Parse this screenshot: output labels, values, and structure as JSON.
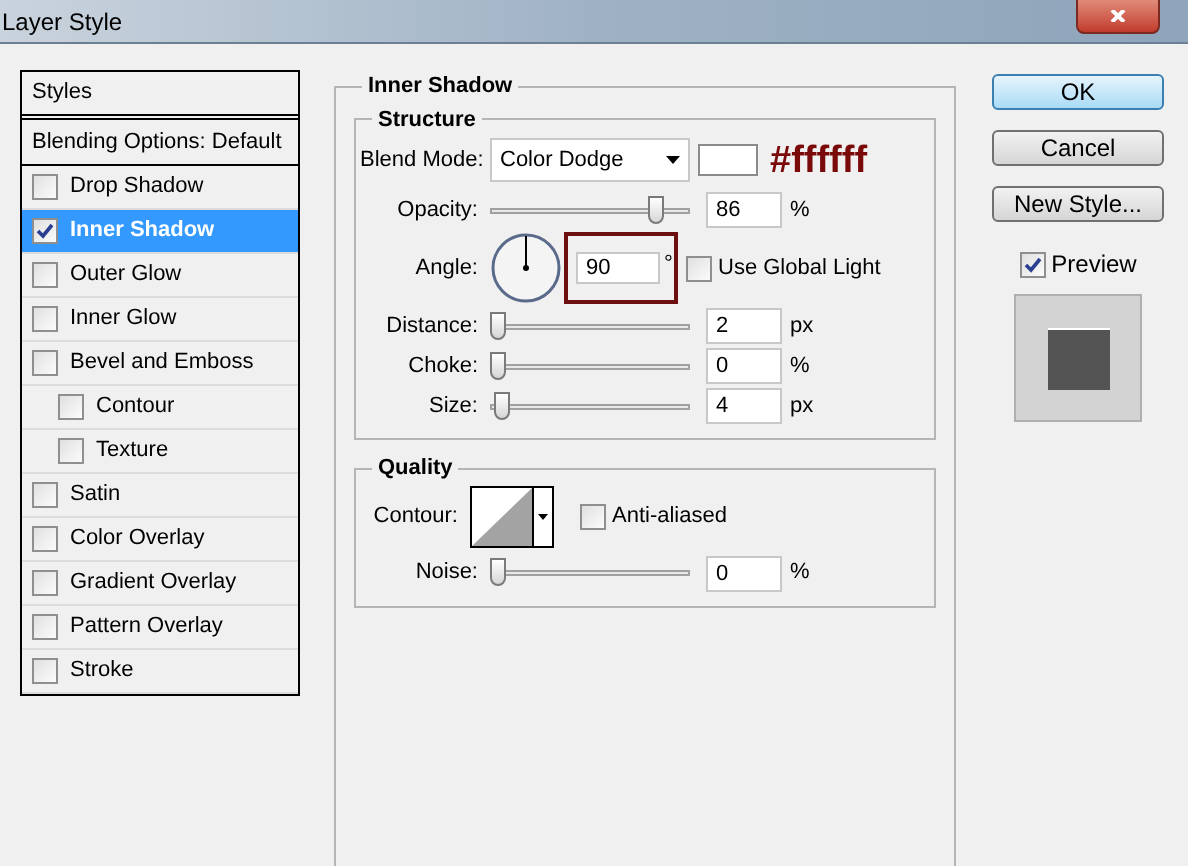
{
  "window": {
    "title": "Layer Style"
  },
  "styles_panel": {
    "header": "Styles",
    "blending_options": "Blending Options: Default",
    "items": [
      {
        "label": "Drop Shadow",
        "checked": false,
        "selected": false
      },
      {
        "label": "Inner Shadow",
        "checked": true,
        "selected": true
      },
      {
        "label": "Outer Glow",
        "checked": false,
        "selected": false
      },
      {
        "label": "Inner Glow",
        "checked": false,
        "selected": false
      },
      {
        "label": "Bevel and Emboss",
        "checked": false,
        "selected": false,
        "children": [
          {
            "label": "Contour",
            "checked": false,
            "selected": false
          },
          {
            "label": "Texture",
            "checked": false,
            "selected": false
          }
        ]
      },
      {
        "label": "Satin",
        "checked": false,
        "selected": false
      },
      {
        "label": "Color Overlay",
        "checked": false,
        "selected": false
      },
      {
        "label": "Gradient Overlay",
        "checked": false,
        "selected": false
      },
      {
        "label": "Pattern Overlay",
        "checked": false,
        "selected": false
      },
      {
        "label": "Stroke",
        "checked": false,
        "selected": false
      }
    ]
  },
  "effect": {
    "title": "Inner Shadow",
    "structure": {
      "title": "Structure",
      "blend_mode": {
        "label": "Blend Mode:",
        "value": "Color Dodge",
        "color": "#ffffff",
        "annotation": "#ffffff"
      },
      "sliders_top": [
        {
          "label": "Opacity:",
          "level": 0.86,
          "value": "86",
          "unit": "%"
        }
      ],
      "angle": {
        "label": "Angle:",
        "value": "90",
        "unit": "°",
        "highlighted": true,
        "global_light": {
          "label": "Use Global Light",
          "checked": false
        }
      },
      "sliders": [
        {
          "label": "Distance:",
          "level": 0.0,
          "value": "2",
          "unit": "px"
        },
        {
          "label": "Choke:",
          "level": 0.0,
          "value": "0",
          "unit": "%"
        },
        {
          "label": "Size:",
          "level": 0.02,
          "value": "4",
          "unit": "px"
        }
      ]
    },
    "quality": {
      "title": "Quality",
      "contour_label": "Contour:",
      "anti_aliased": {
        "label": "Anti-aliased",
        "checked": false
      },
      "sliders": [
        {
          "label": "Noise:",
          "level": 0.0,
          "value": "0",
          "unit": "%"
        }
      ]
    }
  },
  "buttons": [
    {
      "label": "OK",
      "default": true
    },
    {
      "label": "Cancel",
      "default": false
    },
    {
      "label": "New Style...",
      "default": false
    }
  ],
  "preview": {
    "label": "Preview",
    "checked": true
  }
}
